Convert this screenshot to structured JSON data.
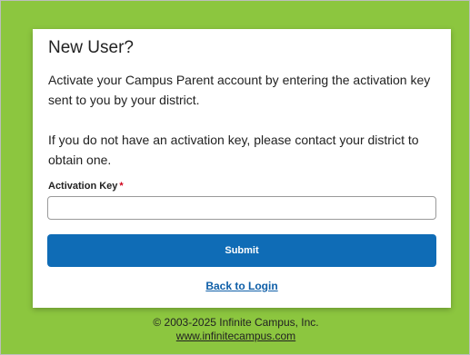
{
  "card": {
    "title": "New User?",
    "intro": "Activate your Campus Parent account by entering the activation key sent to you by your district.",
    "help": "If you do not have an activation key, please contact your district to obtain one.",
    "field_label": "Activation Key",
    "required_marker": "*",
    "field_value": "",
    "submit_label": "Submit",
    "back_link": "Back to Login"
  },
  "footer": {
    "copyright": "© 2003-2025 Infinite Campus, Inc.",
    "website": "www.infinitecampus.com"
  },
  "colors": {
    "background": "#8cc63f",
    "button": "#0f6cb6",
    "link": "#0f5fa8",
    "required": "#d0021b"
  }
}
